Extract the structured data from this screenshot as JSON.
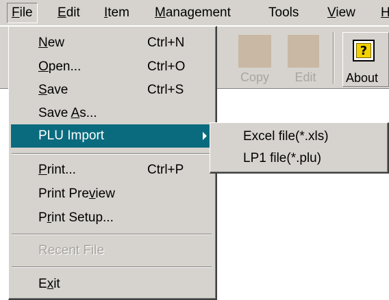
{
  "menubar": {
    "items": [
      {
        "label": "File",
        "mnemonic": "F",
        "rest": "ile"
      },
      {
        "label": "Edit",
        "mnemonic": "E",
        "rest": "dit"
      },
      {
        "label": "Item",
        "mnemonic": "I",
        "rest": "tem"
      },
      {
        "label": "Management",
        "mnemonic": "M",
        "rest": "anagement"
      },
      {
        "label": "Tools"
      },
      {
        "label": "View",
        "mnemonic": "V",
        "rest": "iew"
      },
      {
        "label": "H",
        "mnemonic": "H",
        "rest": ""
      }
    ]
  },
  "toolbar": {
    "copy_label": "Copy",
    "edit_label": "Edit",
    "about_label": "About",
    "help_glyph": "?"
  },
  "file_menu": {
    "new": {
      "pre": "",
      "mnemonic": "N",
      "post": "ew",
      "shortcut": "Ctrl+N"
    },
    "open": {
      "pre": "",
      "mnemonic": "O",
      "post": "pen...",
      "shortcut": "Ctrl+O"
    },
    "save": {
      "pre": "",
      "mnemonic": "S",
      "post": "ave",
      "shortcut": "Ctrl+S"
    },
    "save_as": {
      "pre": "Save ",
      "mnemonic": "A",
      "post": "s..."
    },
    "plu_import": {
      "label": "PLU Import"
    },
    "print": {
      "pre": "",
      "mnemonic": "P",
      "post": "rint...",
      "shortcut": "Ctrl+P"
    },
    "print_preview": {
      "pre": "Print Pre",
      "mnemonic": "v",
      "post": "iew"
    },
    "print_setup": {
      "pre": "P",
      "mnemonic": "r",
      "post": "int Setup..."
    },
    "recent_file": {
      "label": "Recent File"
    },
    "exit": {
      "pre": "E",
      "mnemonic": "x",
      "post": "it"
    }
  },
  "plu_submenu": {
    "items": [
      {
        "label": "Excel file(*.xls)"
      },
      {
        "label": "LP1 file(*.plu)"
      }
    ]
  },
  "colors": {
    "menu_bg": "#d6d3ce",
    "highlight": "#0a6b7f",
    "disabled_text": "#a8a5a0"
  }
}
